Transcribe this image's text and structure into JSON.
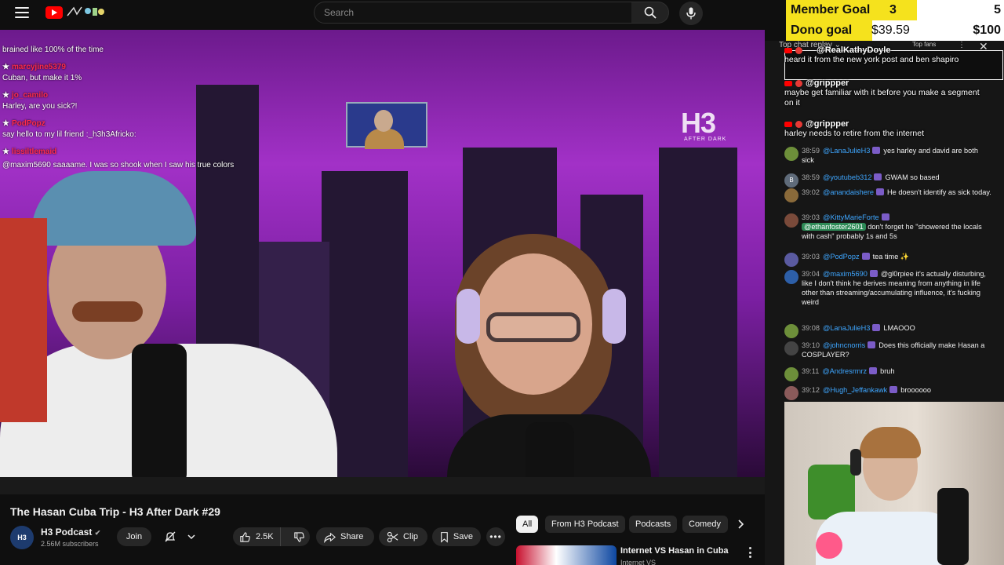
{
  "search": {
    "placeholder": "Search"
  },
  "video": {
    "brand_mark": "H3",
    "brand_sub": "AFTER DARK"
  },
  "video_chat_overlay": [
    {
      "name": "",
      "text": "brained like 100% of the time"
    },
    {
      "name": "marcyjine5379",
      "text": "Cuban, but make it 1%"
    },
    {
      "name": "jo_camilo",
      "text": "Harley, are you sick?!"
    },
    {
      "name": "PodPopz",
      "text": "say hello to my lil friend :_h3h3Africko:"
    },
    {
      "name": "lissiltlemaid",
      "text": "@maxim5690 saaaame. I was so shook when I saw his true colors"
    }
  ],
  "goals": {
    "member": {
      "label": "Member Goal",
      "current": "3",
      "target": "5",
      "progress": 0.6
    },
    "dono": {
      "label": "Dono goal",
      "current": "$39.59",
      "target": "$100",
      "progress": 0.3959
    }
  },
  "side_chat": {
    "header": "Top chat replay",
    "top_fans": "Top fans",
    "super_chats": [
      {
        "user": "@RealKathyDoyle",
        "text": "heard it from the new york post and ben shapiro"
      },
      {
        "user": "@grippper",
        "text": "maybe get familiar with it before you make a segment on it"
      },
      {
        "user": "@grippper",
        "text": "harley needs to retire from the internet"
      }
    ],
    "messages": [
      {
        "time": "38:59",
        "user": "@LanaJulieH3",
        "text": "yes harley and david are both sick",
        "avatar_color": "#6d8f3a",
        "avatar_letter": ""
      },
      {
        "time": "38:59",
        "user": "@youtubeb312",
        "text": "GWAM so based",
        "avatar_color": "#5f6b7a",
        "avatar_letter": "B"
      },
      {
        "time": "39:02",
        "user": "@anandaishere",
        "text": "He doesn't identify as sick today.",
        "avatar_color": "#8a6a3a",
        "avatar_letter": ""
      },
      {
        "time": "39:03",
        "user": "@KittyMarieForte",
        "mention": "@ethanfoster2601",
        "text": "don't forget he \"showered the locals with cash\" probably 1s and 5s",
        "avatar_color": "#7a4a3a",
        "avatar_letter": ""
      },
      {
        "time": "39:03",
        "user": "@PodPopz",
        "text": "tea time ✨",
        "avatar_color": "#5a5aa0",
        "avatar_letter": ""
      },
      {
        "time": "39:04",
        "user": "@maxim5690",
        "text": "@gl0rpiee it's actually disturbing, like I don't think he derives meaning from anything in life other than streaming/accumulating influence, it's fucking weird",
        "avatar_color": "#2d5fa8",
        "avatar_letter": ""
      },
      {
        "time": "39:08",
        "user": "@LanaJulieH3",
        "text": "LMAOOO",
        "avatar_color": "#6d8f3a",
        "avatar_letter": ""
      },
      {
        "time": "39:10",
        "user": "@johncnorris",
        "text": "Does this officially make Hasan a COSPLAYER?",
        "avatar_color": "#444444",
        "avatar_letter": ""
      },
      {
        "time": "39:11",
        "user": "@Andresrmrz",
        "text": "bruh",
        "avatar_color": "#6d8f3a",
        "avatar_letter": ""
      },
      {
        "time": "39:12",
        "user": "@Hugh_Jeffankawk",
        "text": "broooooo",
        "avatar_color": "#8a5a5a",
        "avatar_letter": ""
      }
    ]
  },
  "below_video": {
    "title": "The Hasan Cuba Trip - H3 After Dark #29",
    "channel": "H3 Podcast",
    "avatar_text": "H3",
    "subscribers": "2.56M subscribers",
    "join": "Join",
    "likes": "2.5K",
    "share": "Share",
    "clip": "Clip",
    "save": "Save"
  },
  "chips": [
    "All",
    "From H3 Podcast",
    "Podcasts",
    "Comedy"
  ],
  "recommendation": {
    "title": "Internet VS Hasan in Cuba",
    "sub": "Internet VS"
  },
  "colors": {
    "accent_red": "#ff0000",
    "goal_yellow": "#f5e21d",
    "link_blue": "#3ea6ff"
  }
}
